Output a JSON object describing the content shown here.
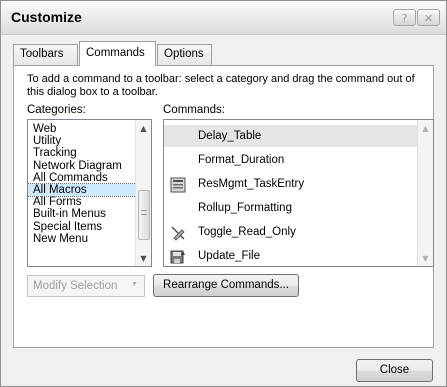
{
  "dialog": {
    "title": "Customize"
  },
  "titlebar": {
    "help_label": "?",
    "close_label": "✕"
  },
  "tabs": [
    {
      "label": "Toolbars"
    },
    {
      "label": "Commands"
    },
    {
      "label": "Options"
    }
  ],
  "instruction": "To add a command to a toolbar: select a category and drag the command out of this dialog box to a toolbar.",
  "categories": {
    "label": "Categories:",
    "items": [
      "Web",
      "Utility",
      "Tracking",
      "Network Diagram",
      "All Commands",
      "All Macros",
      "All Forms",
      "Built-in Menus",
      "Special Items",
      "New Menu"
    ],
    "selected": "All Macros"
  },
  "commands": {
    "label": "Commands:",
    "items": [
      {
        "label": "Delay_Table",
        "icon": "none"
      },
      {
        "label": "Format_Duration",
        "icon": "none"
      },
      {
        "label": "ResMgmt_TaskEntry",
        "icon": "form-icon"
      },
      {
        "label": "Rollup_Formatting",
        "icon": "none"
      },
      {
        "label": "Toggle_Read_Only",
        "icon": "pencil-slash-icon"
      },
      {
        "label": "Update_File",
        "icon": "save-update-icon"
      }
    ],
    "selected": "Delay_Table"
  },
  "modify_selection": {
    "label": "Modify Selection",
    "arrow": "▼"
  },
  "rearrange_button": {
    "label": "Rearrange Commands..."
  },
  "close_button": {
    "label": "Close"
  }
}
